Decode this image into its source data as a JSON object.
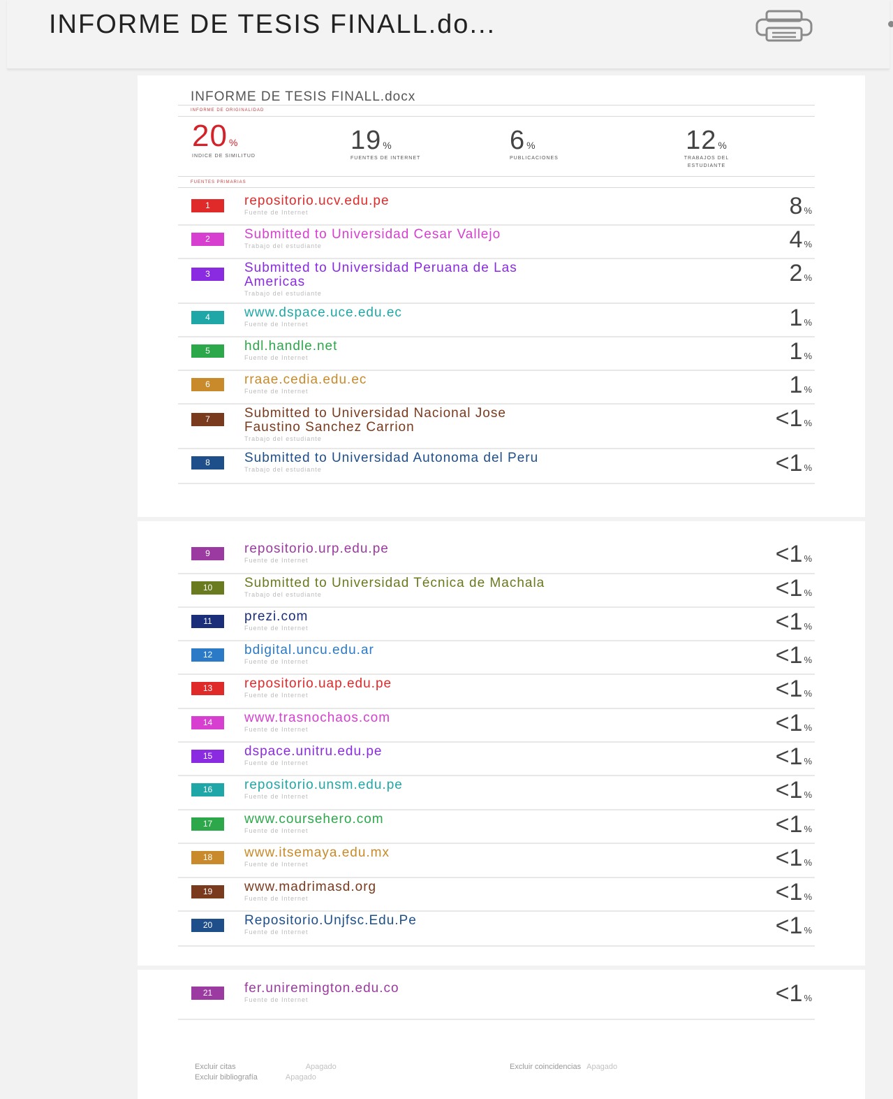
{
  "app": {
    "doc_title": "INFORME DE TESIS FINALL.do...",
    "print_icon": "printer-icon"
  },
  "report": {
    "title": "INFORME DE TESIS FINALL.docx",
    "originality_caption": "INFORME DE ORIGINALIDAD",
    "stats": [
      {
        "value": "20",
        "unit": "%",
        "label": "INDICE DE SIMILITUD"
      },
      {
        "value": "19",
        "unit": "%",
        "label": "FUENTES DE INTERNET"
      },
      {
        "value": "6",
        "unit": "%",
        "label": "PUBLICACIONES"
      },
      {
        "value": "12",
        "unit": "%",
        "label": "TRABAJOS DEL\nESTUDIANTE"
      }
    ],
    "primary_sources_caption": "FUENTES PRIMARIAS"
  },
  "sources": [
    {
      "num": "1",
      "name": "repositorio.ucv.edu.pe",
      "type": "Fuente de Internet",
      "value": "8",
      "unit": "%",
      "color": "#e02a2a"
    },
    {
      "num": "2",
      "name": "Submitted to Universidad Cesar Vallejo",
      "type": "Trabajo del estudiante",
      "value": "4",
      "unit": "%",
      "color": "#d63fcf"
    },
    {
      "num": "3",
      "name": "Submitted to Universidad Peruana de Las\nAmericas",
      "type": "Trabajo del estudiante",
      "value": "2",
      "unit": "%",
      "color": "#8a2be2"
    },
    {
      "num": "4",
      "name": "www.dspace.uce.edu.ec",
      "type": "Fuente de Internet",
      "value": "1",
      "unit": "%",
      "color": "#1fa7a7"
    },
    {
      "num": "5",
      "name": "hdl.handle.net",
      "type": "Fuente de Internet",
      "value": "1",
      "unit": "%",
      "color": "#2ca84a"
    },
    {
      "num": "6",
      "name": "rraae.cedia.edu.ec",
      "type": "Fuente de Internet",
      "value": "1",
      "unit": "%",
      "color": "#c88a2a"
    },
    {
      "num": "7",
      "name": "Submitted to Universidad Nacional Jose\nFaustino Sanchez Carrion",
      "type": "Trabajo del estudiante",
      "value": "<1",
      "unit": "%",
      "color": "#7a3a1e"
    },
    {
      "num": "8",
      "name": "Submitted to Universidad Autonoma del Peru",
      "type": "Trabajo del estudiante",
      "value": "<1",
      "unit": "%",
      "color": "#1e4f8a"
    },
    {
      "num": "9",
      "name": "repositorio.urp.edu.pe",
      "type": "Fuente de Internet",
      "value": "<1",
      "unit": "%",
      "color": "#9b3aa0"
    },
    {
      "num": "10",
      "name": "Submitted to Universidad Técnica de Machala",
      "type": "Trabajo del estudiante",
      "value": "<1",
      "unit": "%",
      "color": "#6a7a1e"
    },
    {
      "num": "11",
      "name": "prezi.com",
      "type": "Fuente de Internet",
      "value": "<1",
      "unit": "%",
      "color": "#1a2e7a"
    },
    {
      "num": "12",
      "name": "bdigital.uncu.edu.ar",
      "type": "Fuente de Internet",
      "value": "<1",
      "unit": "%",
      "color": "#2a7ac8"
    },
    {
      "num": "13",
      "name": "repositorio.uap.edu.pe",
      "type": "Fuente de Internet",
      "value": "<1",
      "unit": "%",
      "color": "#e02a2a"
    },
    {
      "num": "14",
      "name": "www.trasnochaos.com",
      "type": "Fuente de Internet",
      "value": "<1",
      "unit": "%",
      "color": "#d63fcf"
    },
    {
      "num": "15",
      "name": "dspace.unitru.edu.pe",
      "type": "Fuente de Internet",
      "value": "<1",
      "unit": "%",
      "color": "#8a2be2"
    },
    {
      "num": "16",
      "name": "repositorio.unsm.edu.pe",
      "type": "Fuente de Internet",
      "value": "<1",
      "unit": "%",
      "color": "#1fa7a7"
    },
    {
      "num": "17",
      "name": "www.coursehero.com",
      "type": "Fuente de Internet",
      "value": "<1",
      "unit": "%",
      "color": "#2ca84a"
    },
    {
      "num": "18",
      "name": "www.itsemaya.edu.mx",
      "type": "Fuente de Internet",
      "value": "<1",
      "unit": "%",
      "color": "#c88a2a"
    },
    {
      "num": "19",
      "name": "www.madrimasd.org",
      "type": "Fuente de Internet",
      "value": "<1",
      "unit": "%",
      "color": "#7a3a1e"
    },
    {
      "num": "20",
      "name": "Repositorio.Unjfsc.Edu.Pe",
      "type": "Fuente de Internet",
      "value": "<1",
      "unit": "%",
      "color": "#1e4f8a"
    },
    {
      "num": "21",
      "name": "fer.uniremington.edu.co",
      "type": "Fuente de Internet",
      "value": "<1",
      "unit": "%",
      "color": "#9b3aa0"
    }
  ],
  "footer": {
    "exclude_quotes": "Excluir citas",
    "exclude_bibliography": "Excluir bibliografía",
    "exclude_matches": "Excluir coincidencias",
    "option_value": "Apagado"
  }
}
